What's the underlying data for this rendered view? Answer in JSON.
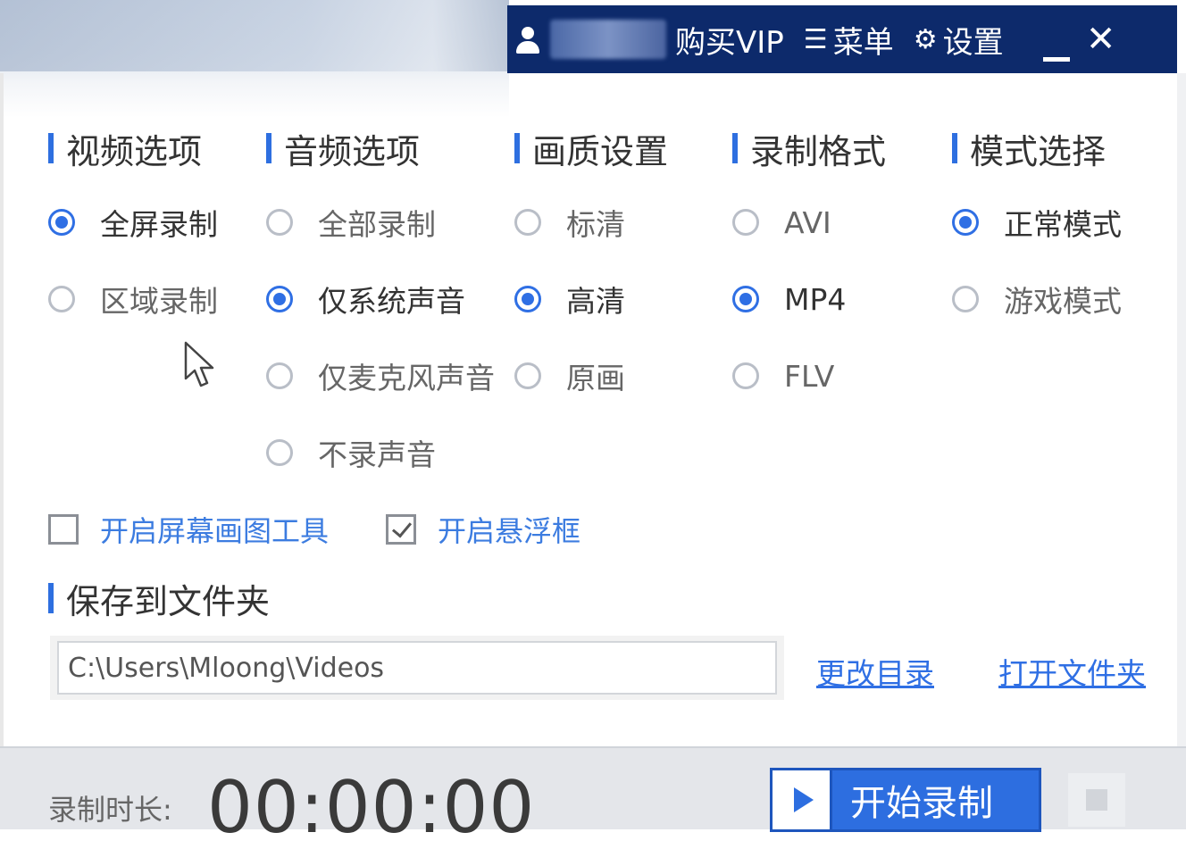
{
  "titlebar": {
    "buy_vip": "购买VIP",
    "menu": "菜单",
    "settings": "设置",
    "menu_glyph": "☰",
    "settings_glyph": "⚙",
    "close_glyph": "✕"
  },
  "sections": {
    "video": {
      "title": "视频选项",
      "options": [
        {
          "label": "全屏录制",
          "selected": true
        },
        {
          "label": "区域录制",
          "selected": false
        }
      ]
    },
    "audio": {
      "title": "音频选项",
      "options": [
        {
          "label": "全部录制",
          "selected": false
        },
        {
          "label": "仅系统声音",
          "selected": true
        },
        {
          "label": "仅麦克风声音",
          "selected": false
        },
        {
          "label": "不录声音",
          "selected": false
        }
      ]
    },
    "quality": {
      "title": "画质设置",
      "options": [
        {
          "label": "标清",
          "selected": false
        },
        {
          "label": "高清",
          "selected": true
        },
        {
          "label": "原画",
          "selected": false
        }
      ]
    },
    "format": {
      "title": "录制格式",
      "options": [
        {
          "label": "AVI",
          "selected": false
        },
        {
          "label": "MP4",
          "selected": true
        },
        {
          "label": "FLV",
          "selected": false
        }
      ]
    },
    "mode": {
      "title": "模式选择",
      "options": [
        {
          "label": "正常模式",
          "selected": true
        },
        {
          "label": "游戏模式",
          "selected": false
        }
      ]
    }
  },
  "checkboxes": {
    "drawing_tool": {
      "label": "开启屏幕画图工具",
      "checked": false
    },
    "floating_window": {
      "label": "开启悬浮框",
      "checked": true
    }
  },
  "save": {
    "title": "保存到文件夹",
    "path": "C:\\Users\\Mloong\\Videos",
    "change_dir": "更改目录",
    "open_folder": "打开文件夹"
  },
  "bottom": {
    "duration_label": "录制时长:",
    "duration_value": "00:00:00",
    "start_button": "开始录制"
  },
  "colors": {
    "titlebar_bg": "#0d2a6b",
    "accent": "#2f6fe4",
    "link": "#3c7ce0"
  }
}
